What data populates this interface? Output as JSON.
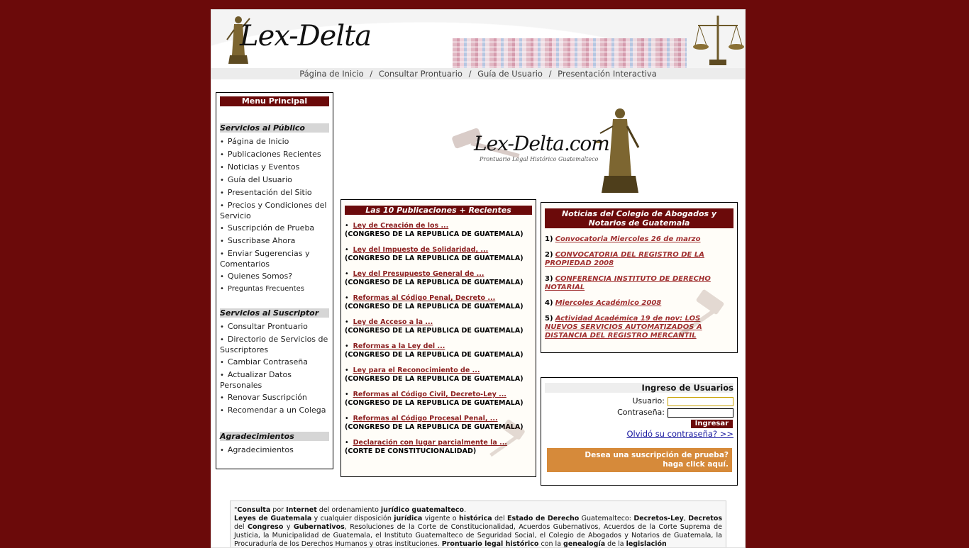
{
  "colors": {
    "background": "#6b0a0a",
    "box_title_bg": "#6b0a0a",
    "link": "#8b1d1d",
    "trial_banner": "#d68a3a",
    "forgot_link": "#1a1aa0"
  },
  "header": {
    "logo_text": "Lex-Delta",
    "nav": [
      "Página de Inicio",
      "Consultar Prontuario",
      "Guía de Usuario",
      "Presentación Interactiva"
    ],
    "nav_separator": "/"
  },
  "menu": {
    "title": "Menu Principal",
    "sections": [
      {
        "title": "Servicios al Público",
        "items": [
          "Página de Inicio",
          "Publicaciones Recientes",
          "Noticias y Eventos",
          "Guía del Usuario",
          "Presentación del Sitio",
          "Precios y Condiciones del Servicio",
          "Suscripción de Prueba",
          "Suscribase Ahora",
          "Enviar Sugerencias y Comentarios",
          "Quienes Somos?",
          "Preguntas Frecuentes"
        ]
      },
      {
        "title": "Servicios al Suscriptor",
        "items": [
          "Consultar Prontuario",
          "Directorio de Servicios de Suscriptores",
          "Cambiar Contraseña",
          "Actualizar Datos Personales",
          "Renovar Suscripción",
          "Recomendar a un Colega"
        ]
      },
      {
        "title": "Agradecimientos",
        "items": [
          "Agradecimientos"
        ]
      }
    ]
  },
  "center_logo": {
    "title": "Lex-Delta.com",
    "subtitle": "Prontuario Legal Histórico Guatemalteco"
  },
  "publications": {
    "title": "Las 10 Publicaciones + Recientes",
    "items": [
      {
        "link": "Ley de Creación de los ...",
        "source": "(CONGRESO DE LA REPUBLICA DE GUATEMALA)"
      },
      {
        "link": "Ley del Impuesto de Solidaridad, ...",
        "source": "(CONGRESO DE LA REPUBLICA DE GUATEMALA)"
      },
      {
        "link": "Ley del Presupuesto General de ...",
        "source": "(CONGRESO DE LA REPUBLICA DE GUATEMALA)"
      },
      {
        "link": "Reformas al Código Penal, Decreto ...",
        "source": "(CONGRESO DE LA REPUBLICA DE GUATEMALA)"
      },
      {
        "link": "Ley de Acceso a la ...",
        "source": "(CONGRESO DE LA REPUBLICA DE GUATEMALA)"
      },
      {
        "link": "Reformas a la Ley del ...",
        "source": "(CONGRESO DE LA REPUBLICA DE GUATEMALA)"
      },
      {
        "link": "Ley para el Reconocimiento de ...",
        "source": "(CONGRESO DE LA REPUBLICA DE GUATEMALA)"
      },
      {
        "link": "Reformas al Código Civil, Decreto-Ley ...",
        "source": "(CONGRESO DE LA REPUBLICA DE GUATEMALA)"
      },
      {
        "link": "Reformas al Código Procesal Penal, ...",
        "source": "(CONGRESO DE LA REPUBLICA DE GUATEMALA)"
      },
      {
        "link": "Declaración con lugar parcialmente la ...",
        "source": "(CORTE DE CONSTITUCIONALIDAD)"
      }
    ]
  },
  "news": {
    "title": "Noticias del Colegio de Abogados y Notarios de Guatemala",
    "items": [
      {
        "num": "1)",
        "text": "Convocatoria Miercoles 26 de marzo"
      },
      {
        "num": "2)",
        "text": "CONVOCATORIA DEL REGISTRO DE LA PROPIEDAD 2008"
      },
      {
        "num": "3)",
        "text": "CONFERENCIA INSTITUTO DE DERECHO NOTARIAL"
      },
      {
        "num": "4)",
        "text": "Miercoles Académico 2008"
      },
      {
        "num": "5)",
        "text": "Actividad Académica 19 de nov: LOS NUEVOS SERVICIOS AUTOMATIZADOS A DISTANCIA DEL REGISTRO MERCANTIL"
      }
    ]
  },
  "login": {
    "title": "Ingreso de Usuarios",
    "user_label": "Usuario:",
    "user_value": "",
    "pass_label": "Contraseña:",
    "pass_value": "",
    "submit": "Ingresar",
    "forgot": "Olvidó su contraseña? >>",
    "trial_line1": "Desea una suscripción de prueba?",
    "trial_line2": "haga click aquí."
  },
  "description": {
    "line1_parts": [
      "\"",
      "Consulta",
      " por ",
      "Internet",
      " del ordenamiento ",
      "jurídico guatemalteco",
      "."
    ],
    "line2_parts": [
      "Leyes de Guatemala",
      " y cualquier disposición ",
      "jurídica",
      " vigente o ",
      "histórica",
      " del ",
      "Estado de Derecho",
      " Guatemalteco: ",
      "Decretos-Ley",
      ", ",
      "Decretos",
      " del ",
      "Congreso",
      " y ",
      "Gubernativos",
      ", Resoluciones de la Corte de Constitucionalidad, Acuerdos Gubernativos, Acuerdos de la Corte Suprema de Justicia, la Municipalidad de Guatemala, el Instituto Guatemalteco de Seguridad Social, el Colegio de Abogados y Notarios de Guatemala, la Procuraduría de los Derechos Humanos y otras instituciones. ",
      "Prontuario legal histórico",
      " con la ",
      "genealogía",
      " de la ",
      "legislación"
    ]
  }
}
